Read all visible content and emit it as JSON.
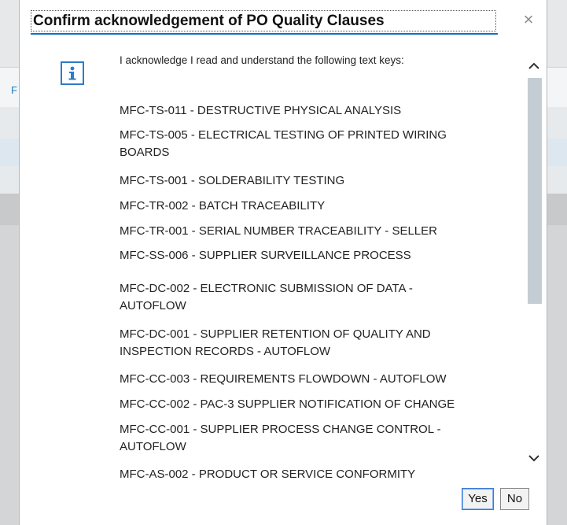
{
  "background": {
    "partial_text": "F"
  },
  "dialog": {
    "title": "Confirm acknowledgement of PO Quality Clauses",
    "close_symbol": "×",
    "icon": "info-icon",
    "intro": "I acknowledge I read and understand the following text keys:",
    "items": [
      {
        "line1": "MFC-TS-011 - DESTRUCTIVE PHYSICAL ANALYSIS",
        "line2": ""
      },
      {
        "line1": "MFC-TS-005 - ELECTRICAL TESTING OF PRINTED WIRING",
        "line2": "BOARDS"
      },
      {
        "line1": "MFC-TS-001 - SOLDERABILITY TESTING",
        "line2": ""
      },
      {
        "line1": "MFC-TR-002 - BATCH TRACEABILITY",
        "line2": ""
      },
      {
        "line1": "MFC-TR-001 - SERIAL NUMBER TRACEABILITY - SELLER",
        "line2": ""
      },
      {
        "line1": "MFC-SS-006 - SUPPLIER SURVEILLANCE PROCESS",
        "line2": ""
      },
      {
        "line1": "MFC-DC-002 - ELECTRONIC SUBMISSION OF DATA -",
        "line2": "AUTOFLOW"
      },
      {
        "line1": "MFC-DC-001 - SUPPLIER RETENTION OF QUALITY AND",
        "line2": "INSPECTION RECORDS - AUTOFLOW"
      },
      {
        "line1": "MFC-CC-003 - REQUIREMENTS FLOWDOWN - AUTOFLOW",
        "line2": ""
      },
      {
        "line1": "MFC-CC-002 - PAC-3 SUPPLIER NOTIFICATION OF CHANGE",
        "line2": ""
      },
      {
        "line1": "MFC-CC-001 - SUPPLIER PROCESS CHANGE CONTROL -",
        "line2": "AUTOFLOW"
      },
      {
        "line1": "MFC-AS-002 - PRODUCT OR SERVICE CONFORMITY",
        "line2": ""
      }
    ],
    "scroll_position": 0,
    "buttons": {
      "yes": "Yes",
      "no": "No"
    }
  },
  "colors": {
    "accent": "#0a6ed1",
    "info_icon": "#2c7cc7",
    "scroll_thumb": "#c4ccd4"
  }
}
